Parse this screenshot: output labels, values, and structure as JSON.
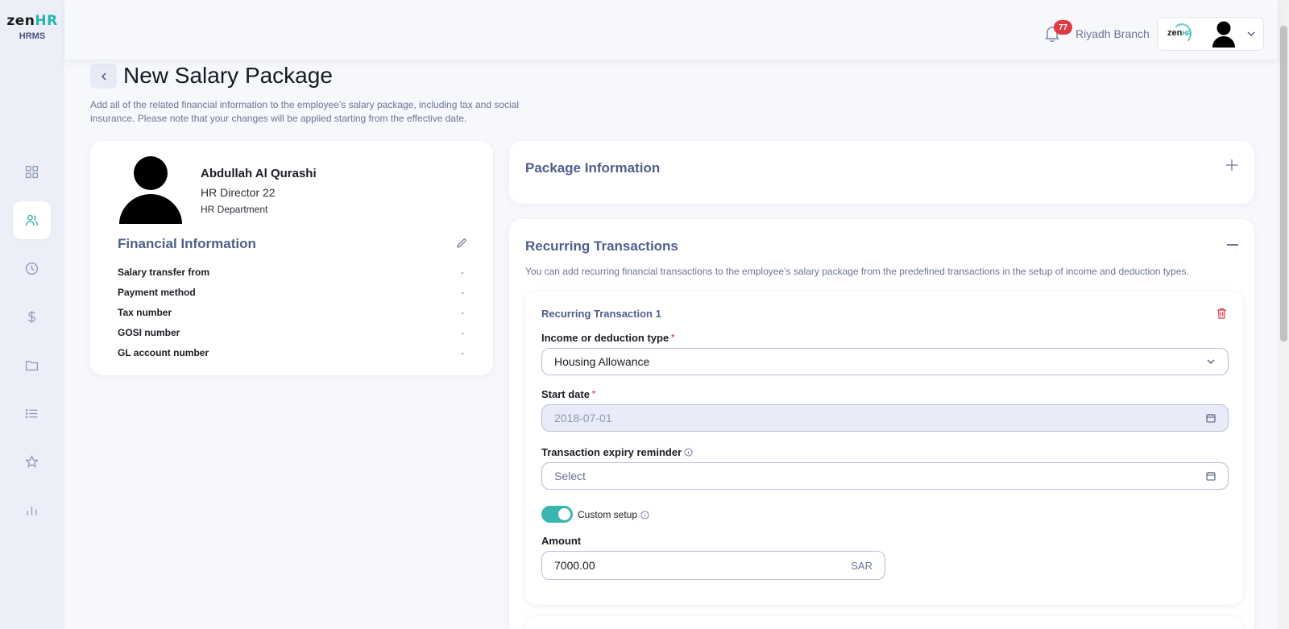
{
  "app": {
    "logo_main": "zen",
    "logo_accent": "HR",
    "logo_sub": "HRMS"
  },
  "sidebar": {
    "items": [
      {
        "icon": "dashboard-grid-icon"
      },
      {
        "icon": "users-icon",
        "active": true
      },
      {
        "icon": "clock-icon"
      },
      {
        "icon": "dollar-icon"
      },
      {
        "icon": "folder-icon"
      },
      {
        "icon": "list-icon"
      },
      {
        "icon": "star-icon"
      },
      {
        "icon": "bar-chart-icon"
      }
    ]
  },
  "topbar": {
    "notification_count": "77",
    "branch": "Riyadh Branch",
    "company_logo_main": "zen",
    "company_logo_accent": "HR"
  },
  "page": {
    "title": "New Salary Package",
    "description": "Add all of the related financial information to the employee’s salary package, including tax and social insurance. Please note that your changes will be applied starting from the effective date."
  },
  "employee": {
    "name": "Abdullah Al Qurashi",
    "role": "HR Director 22",
    "department": "HR Department"
  },
  "financial": {
    "title": "Financial Information",
    "rows": [
      {
        "label": "Salary transfer from",
        "value": "-"
      },
      {
        "label": "Payment method",
        "value": "-"
      },
      {
        "label": "Tax number",
        "value": "-"
      },
      {
        "label": "GOSI number",
        "value": "-"
      },
      {
        "label": "GL account number",
        "value": "-"
      }
    ]
  },
  "package": {
    "title": "Package Information"
  },
  "recurring": {
    "title": "Recurring Transactions",
    "description": "You can add recurring financial transactions to the employee’s salary package from the predefined transactions in the setup of income and deduction types.",
    "transaction": {
      "title": "Recurring Transaction 1",
      "type_label": "Income or deduction type",
      "type_value": "Housing Allowance",
      "start_label": "Start date",
      "start_value": "2018-07-01",
      "expiry_label": "Transaction expiry reminder",
      "expiry_placeholder": "Select",
      "custom_setup_label": "Custom setup",
      "custom_setup_on": true,
      "amount_label": "Amount",
      "amount_value": "7000.00",
      "currency": "SAR"
    }
  },
  "colors": {
    "accent": "#3bb5b1",
    "section_title": "#4f5f8c",
    "badge": "#e03a45"
  }
}
